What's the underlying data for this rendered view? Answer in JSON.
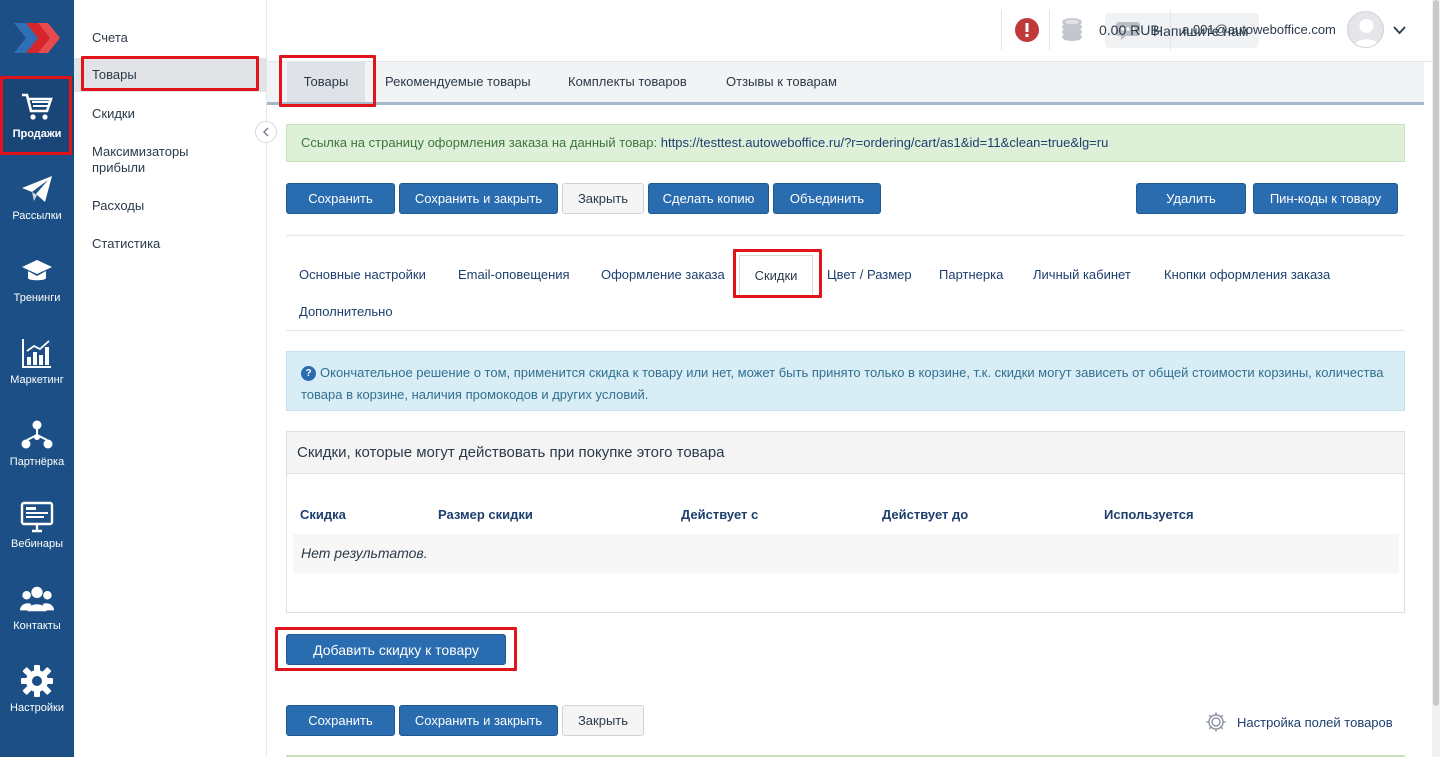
{
  "sidebar": {
    "items": [
      {
        "id": "sales",
        "label": "Продажи",
        "icon": "cart-icon",
        "active": true
      },
      {
        "id": "mailings",
        "label": "Рассылки",
        "icon": "paper-plane-icon"
      },
      {
        "id": "trainings",
        "label": "Тренинги",
        "icon": "graduation-cap-icon"
      },
      {
        "id": "marketing",
        "label": "Маркетинг",
        "icon": "bar-chart-icon"
      },
      {
        "id": "partners",
        "label": "Партнёрка",
        "icon": "network-icon"
      },
      {
        "id": "webinars",
        "label": "Вебинары",
        "icon": "monitor-icon"
      },
      {
        "id": "contacts",
        "label": "Контакты",
        "icon": "users-icon"
      },
      {
        "id": "settings",
        "label": "Настройки",
        "icon": "gear-icon"
      }
    ]
  },
  "submenu": {
    "items": [
      {
        "label": "Счета"
      },
      {
        "label": "Товары",
        "active": true
      },
      {
        "label": "Скидки"
      },
      {
        "label": "Максимизаторы прибыли"
      },
      {
        "label": "Расходы"
      },
      {
        "label": "Статистика"
      }
    ]
  },
  "header": {
    "write_us": "Напишите нам",
    "balance": "0.00 RUB",
    "user_email": "a.001@autoweboffice.com"
  },
  "module_tabs": [
    {
      "label": "Товары",
      "active": true
    },
    {
      "label": "Рекомендуемые товары"
    },
    {
      "label": "Комплекты товаров"
    },
    {
      "label": "Отзывы к товарам"
    }
  ],
  "order_link": {
    "text": "Ссылка на страницу оформления заказа на данный товар:",
    "url": "https://testtest.autoweboffice.ru/?r=ordering/cart/as1&id=11&clean=true&lg=ru"
  },
  "toolbar": {
    "save": "Сохранить",
    "save_close": "Сохранить и закрыть",
    "close": "Закрыть",
    "copy": "Сделать копию",
    "merge": "Объединить",
    "delete": "Удалить",
    "pincodes": "Пин-коды к товару"
  },
  "settings_tabs": [
    {
      "label": "Основные настройки"
    },
    {
      "label": "Email-оповещения"
    },
    {
      "label": "Оформление заказа"
    },
    {
      "label": "Скидки",
      "active": true
    },
    {
      "label": "Цвет / Размер"
    },
    {
      "label": "Партнерка"
    },
    {
      "label": "Личный кабинет"
    },
    {
      "label": "Кнопки оформления заказа"
    },
    {
      "label": "Дополнительно"
    }
  ],
  "info_alert": "Окончательное решение о том, применится скидка к товару или нет, может быть принято только в корзине, т.к. скидки могут зависеть от общей стоимости корзины, количества товара в корзине, наличия промокодов и других условий.",
  "discounts_panel": {
    "title": "Скидки, которые могут действовать при покупке этого товара",
    "columns": [
      "Скидка",
      "Размер скидки",
      "Действует с",
      "Действует до",
      "Используется"
    ],
    "empty_text": "Нет результатов."
  },
  "add_discount_button": "Добавить скидку к товару",
  "bottom_toolbar": {
    "save": "Сохранить",
    "save_close": "Сохранить и закрыть",
    "close": "Закрыть"
  },
  "fields_settings_link": "Настройка полей товаров",
  "colors": {
    "rail": "#1c4f85",
    "primary_button": "#2a6cb0",
    "highlight": "#e1141b",
    "success_bg": "#dff0d8",
    "info_bg": "#d9edf7"
  }
}
